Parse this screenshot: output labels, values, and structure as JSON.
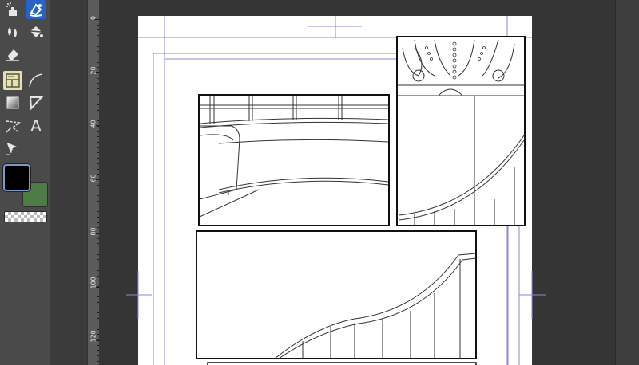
{
  "app": {
    "accent_color": "#2563c9"
  },
  "toolbar": {
    "tools": [
      {
        "name": "airbrush-tool-icon",
        "active": false
      },
      {
        "name": "fill-tool-icon",
        "active": true
      },
      {
        "name": "blend-tool-icon",
        "active": false
      },
      {
        "name": "bucket-tool-icon",
        "active": false
      },
      {
        "name": "eraser-tool-icon",
        "active": false
      },
      {
        "name": "frame-border-tool-icon",
        "active": true
      },
      {
        "name": "curve-tool-icon",
        "active": false
      },
      {
        "name": "gradient-tool-icon",
        "active": false
      },
      {
        "name": "ruler-tool-icon",
        "active": false
      },
      {
        "name": "lasso-tool-icon",
        "active": false
      },
      {
        "name": "text-tool-icon",
        "active": false
      },
      {
        "name": "operation-tool-icon",
        "active": false
      }
    ],
    "text_tool_glyph": "A",
    "main_color": "#000000",
    "sub_color": "#4e7b46"
  },
  "ruler": {
    "labels": [
      "0",
      "20",
      "40",
      "60",
      "80",
      "100",
      "120"
    ]
  }
}
